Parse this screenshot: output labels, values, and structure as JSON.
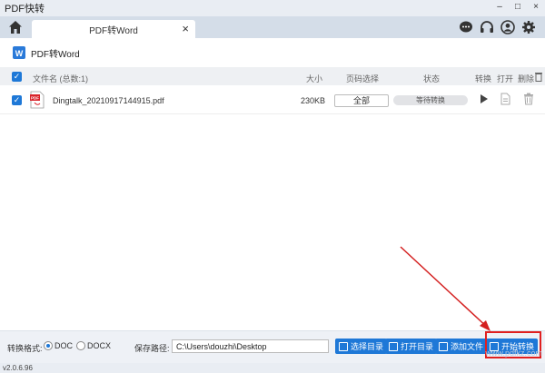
{
  "window": {
    "title": "PDF快转",
    "minimize": "–",
    "maximize": "□",
    "close": "×"
  },
  "tab": {
    "label": "PDF转Word",
    "close": "×"
  },
  "subheader": {
    "title": "PDF转Word"
  },
  "list_header": {
    "filename": "文件名 (总数:1)",
    "size": "大小",
    "pages": "页码选择",
    "status": "状态",
    "convert": "转换",
    "open": "打开",
    "delete": "删除"
  },
  "files": [
    {
      "name": "Dingtalk_20210917144915.pdf",
      "size": "230KB",
      "pages": "全部",
      "status": "等待转换"
    }
  ],
  "footer": {
    "format_label": "转换格式:",
    "format_options": [
      "DOC",
      "DOCX"
    ],
    "selected_format": "DOC",
    "path_label": "保存路径:",
    "path_value": "C:\\Users\\douzhi\\Desktop",
    "btn_select_dir": "选择目录",
    "btn_open_dir": "打开目录",
    "btn_add_file": "添加文件",
    "btn_start": "开始转换"
  },
  "version": "v2.0.6.96",
  "watermark": "www.pdfkz.com",
  "colors": {
    "accent": "#1e78d7",
    "highlight": "#e02020"
  }
}
